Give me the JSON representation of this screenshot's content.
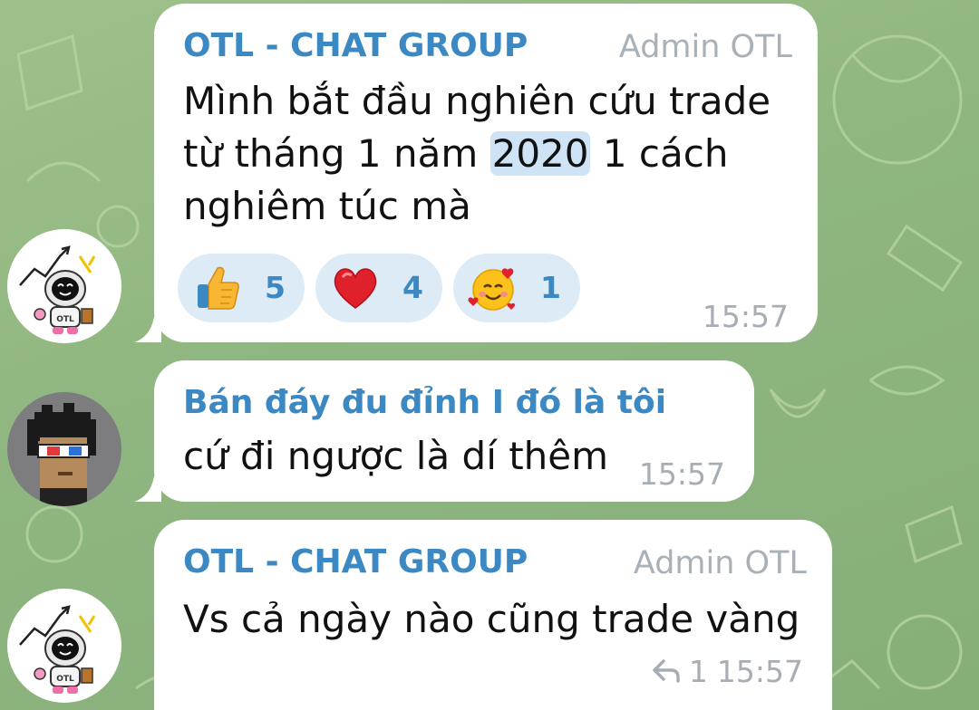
{
  "messages": [
    {
      "sender": "OTL - CHAT GROUP",
      "role": "Admin OTL",
      "line1": "Mình bắt đầu nghiên cứu trade",
      "line2_pre": "từ tháng 1 năm ",
      "line2_hl": "2020",
      "line2_post": " 1 cách",
      "line3": "nghiêm túc mà",
      "reactions": [
        {
          "icon": "thumbs-up",
          "count": "5"
        },
        {
          "icon": "red-heart",
          "count": "4"
        },
        {
          "icon": "smiling-face-with-hearts",
          "count": "1"
        }
      ],
      "time": "15:57"
    },
    {
      "sender": "Bán đáy đu đỉnh I đó là tôi",
      "text": "cứ đi ngược là dí thêm",
      "time": "15:57"
    },
    {
      "sender": "OTL - CHAT GROUP",
      "role": "Admin OTL",
      "text": "Vs cả ngày nào cũng trade vàng",
      "reply_count": "1",
      "time": "15:57"
    }
  ],
  "colors": {
    "sender": "#3b88c3",
    "bubble": "#ffffff",
    "background": "#8fb680",
    "reaction_bg": "#ddebf6"
  }
}
